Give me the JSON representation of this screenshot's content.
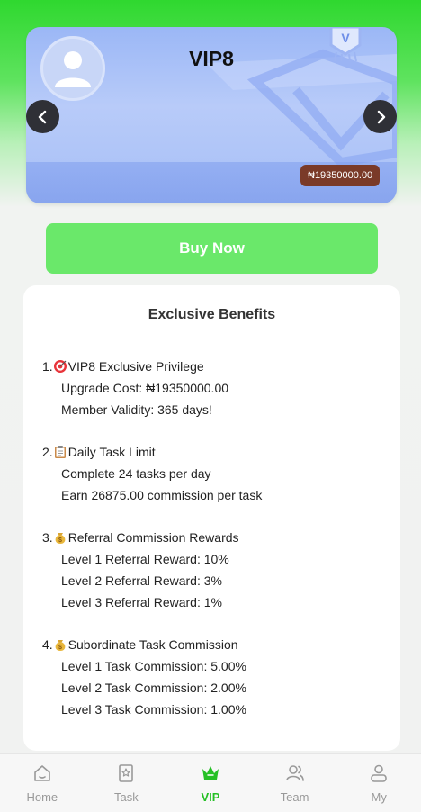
{
  "card": {
    "title": "VIP8",
    "price": "₦19350000.00"
  },
  "buy_button": "Buy Now",
  "benefits": {
    "heading": "Exclusive Benefits",
    "sections": [
      {
        "title": "1.🎯VIP8 Exclusive Privilege",
        "number": "1.",
        "emoji": "target-icon",
        "label": "VIP8 Exclusive Privilege",
        "lines": [
          "Upgrade Cost: ₦19350000.00",
          "Member Validity: 365 days!"
        ]
      },
      {
        "number": "2.",
        "emoji": "clipboard-icon",
        "label": "Daily Task Limit",
        "lines": [
          "Complete 24 tasks per day",
          "Earn 26875.00 commission per task"
        ]
      },
      {
        "number": "3.",
        "emoji": "money-bag-icon",
        "label": "Referral Commission Rewards",
        "lines": [
          "Level 1 Referral Reward: 10%",
          "Level 2 Referral Reward: 3%",
          "Level 3 Referral Reward: 1%"
        ]
      },
      {
        "number": "4.",
        "emoji": "money-bag-icon",
        "label": "Subordinate Task Commission",
        "lines": [
          "Level 1 Task Commission: 5.00%",
          "Level 2 Task Commission: 2.00%",
          "Level 3 Task Commission: 1.00%"
        ]
      }
    ]
  },
  "tabs": [
    {
      "label": "Home",
      "icon": "home-icon",
      "active": false
    },
    {
      "label": "Task",
      "icon": "task-icon",
      "active": false
    },
    {
      "label": "VIP",
      "icon": "crown-icon",
      "active": true
    },
    {
      "label": "Team",
      "icon": "team-icon",
      "active": false
    },
    {
      "label": "My",
      "icon": "user-icon",
      "active": false
    }
  ],
  "colors": {
    "accent": "#25c025",
    "buy_button": "#6ae86a",
    "price_tag": "#7a3a28",
    "card": "#b8cbf9"
  }
}
